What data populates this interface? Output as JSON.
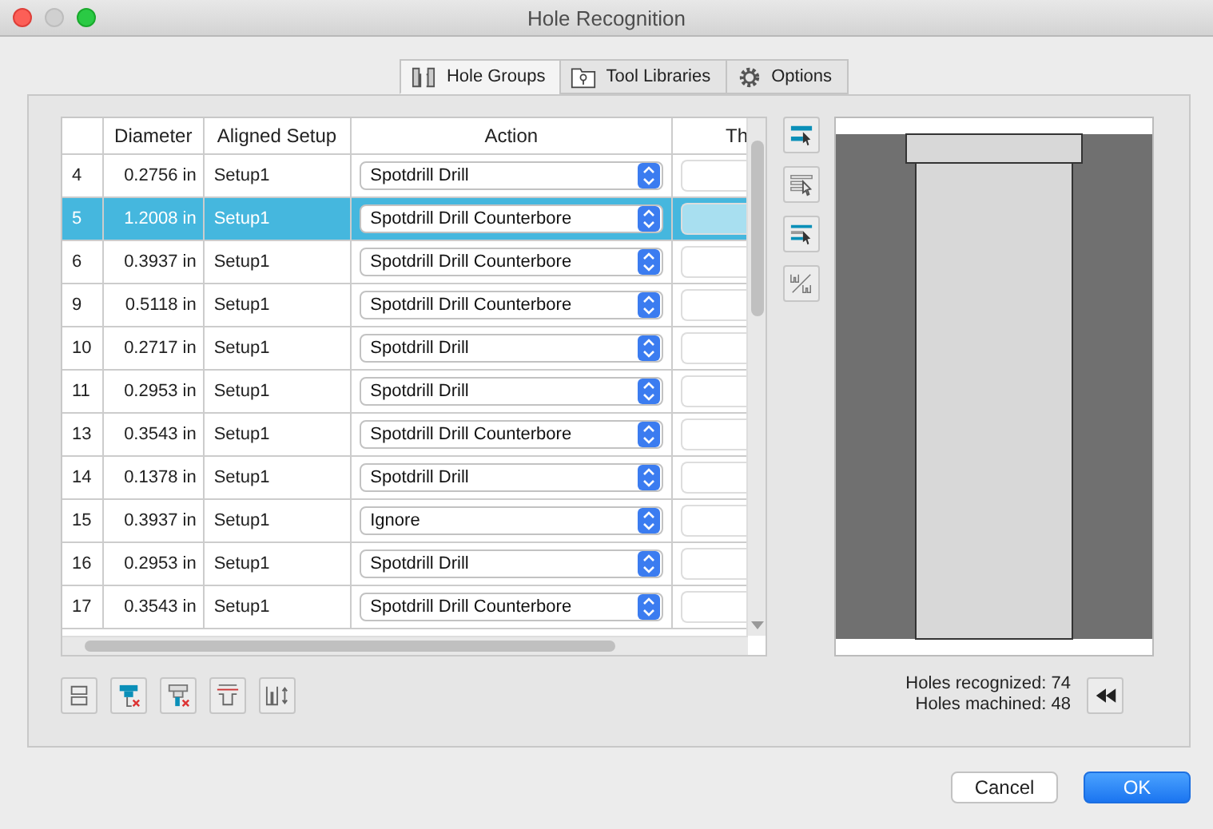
{
  "window": {
    "title": "Hole Recognition"
  },
  "tabs": [
    {
      "label": "Hole Groups",
      "selected": true
    },
    {
      "label": "Tool Libraries",
      "selected": false
    },
    {
      "label": "Options",
      "selected": false
    }
  ],
  "table": {
    "columns": [
      "Diameter",
      "Aligned Setup",
      "Action",
      "Th"
    ],
    "rows": [
      {
        "id": "4",
        "diameter": "0.2756 in",
        "setup": "Setup1",
        "action": "Spotdrill Drill",
        "selected": false
      },
      {
        "id": "5",
        "diameter": "1.2008 in",
        "setup": "Setup1",
        "action": "Spotdrill Drill Counterbore",
        "selected": true
      },
      {
        "id": "6",
        "diameter": "0.3937 in",
        "setup": "Setup1",
        "action": "Spotdrill Drill Counterbore",
        "selected": false
      },
      {
        "id": "9",
        "diameter": "0.5118 in",
        "setup": "Setup1",
        "action": "Spotdrill Drill Counterbore",
        "selected": false
      },
      {
        "id": "10",
        "diameter": "0.2717 in",
        "setup": "Setup1",
        "action": "Spotdrill Drill",
        "selected": false
      },
      {
        "id": "11",
        "diameter": "0.2953 in",
        "setup": "Setup1",
        "action": "Spotdrill Drill",
        "selected": false
      },
      {
        "id": "13",
        "diameter": "0.3543 in",
        "setup": "Setup1",
        "action": "Spotdrill Drill Counterbore",
        "selected": false
      },
      {
        "id": "14",
        "diameter": "0.1378 in",
        "setup": "Setup1",
        "action": "Spotdrill Drill",
        "selected": false
      },
      {
        "id": "15",
        "diameter": "0.3937 in",
        "setup": "Setup1",
        "action": "Ignore",
        "selected": false
      },
      {
        "id": "16",
        "diameter": "0.2953 in",
        "setup": "Setup1",
        "action": "Spotdrill Drill",
        "selected": false
      },
      {
        "id": "17",
        "diameter": "0.3543 in",
        "setup": "Setup1",
        "action": "Spotdrill Drill Counterbore",
        "selected": false
      }
    ]
  },
  "stats": [
    "Holes recognized: 74",
    "Holes machined: 48"
  ],
  "buttons": [
    {
      "label": "Cancel",
      "kind": "normal"
    },
    {
      "label": "OK",
      "kind": "default"
    }
  ]
}
